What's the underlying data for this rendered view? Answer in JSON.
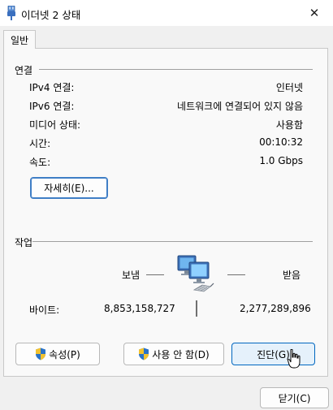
{
  "window": {
    "title": "이더넷 2 상태",
    "close_glyph": "✕",
    "close_label": "닫기"
  },
  "tabs": [
    {
      "label": "일반",
      "selected": true
    }
  ],
  "connection": {
    "group_label": "연결",
    "rows": [
      {
        "label": "IPv4 연결:",
        "value": "인터넷"
      },
      {
        "label": "IPv6 연결:",
        "value": "네트워크에 연결되어 있지 않음"
      },
      {
        "label": "미디어 상태:",
        "value": "사용함"
      },
      {
        "label": "시간:",
        "value": "00:10:32"
      },
      {
        "label": "속도:",
        "value": "1.0 Gbps"
      }
    ],
    "details_button": "자세히(E)..."
  },
  "activity": {
    "group_label": "작업",
    "sent_label": "보냄",
    "received_label": "받음",
    "bytes_label": "바이트:",
    "bytes_sent": "8,853,158,727",
    "bytes_received": "2,277,289,896"
  },
  "buttons": {
    "properties": "속성(P)",
    "disable": "사용 안 함(D)",
    "diagnose": "진단(G)",
    "close": "닫기(C)"
  },
  "colors": {
    "accent": "#0067c0",
    "shield_blue": "#2a73c8",
    "shield_yellow": "#f2c230"
  }
}
